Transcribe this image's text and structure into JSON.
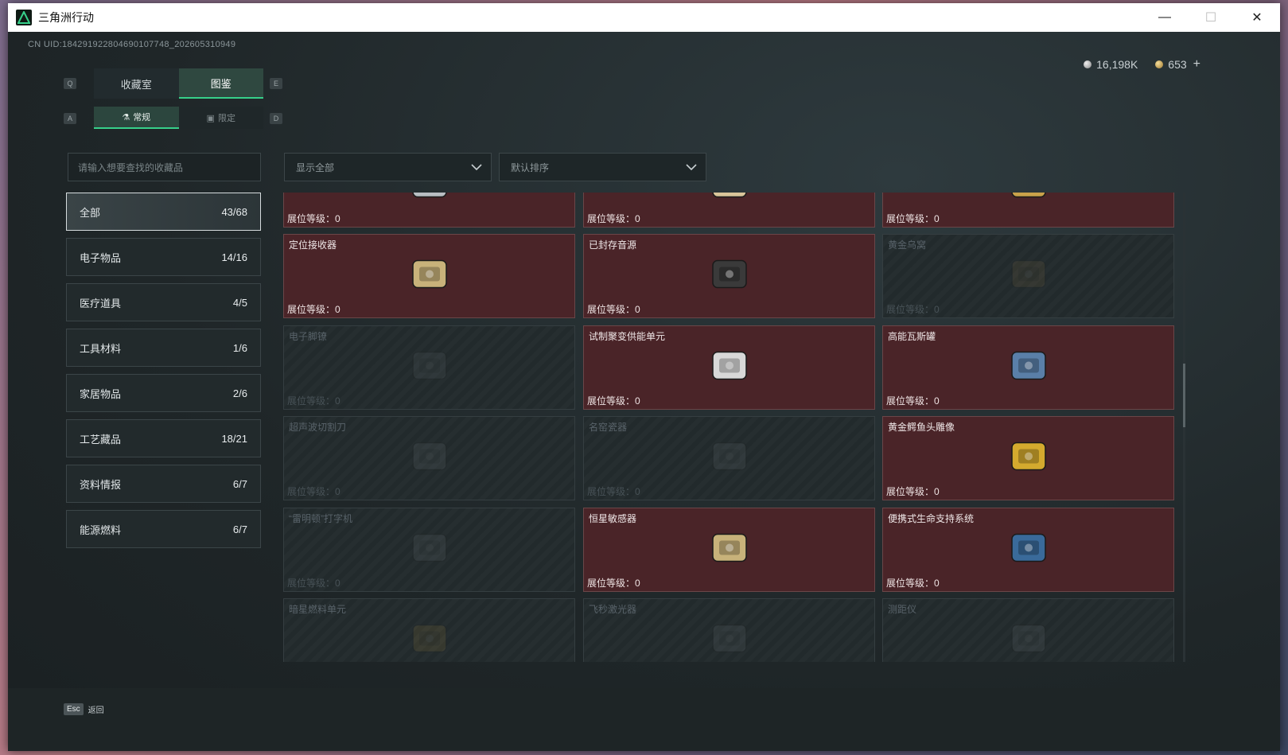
{
  "window": {
    "title": "三角洲行动",
    "controls": {
      "minimize": "—",
      "maximize": "☐",
      "close": "✕"
    }
  },
  "header": {
    "uid": "CN UID:1842919228046901077­48_202605310949",
    "currency_silver": "16,198K",
    "currency_gold": "653",
    "plus": "+"
  },
  "keyhints": {
    "q": "Q",
    "e": "E",
    "a": "A",
    "d": "D"
  },
  "tabs": [
    {
      "label": "收藏室",
      "active": false
    },
    {
      "label": "图鉴",
      "active": true
    }
  ],
  "subtabs": [
    {
      "label": "常规",
      "icon": "flask-icon",
      "active": true
    },
    {
      "label": "限定",
      "icon": "badge-icon",
      "active": false
    }
  ],
  "search": {
    "placeholder": "请输入想要查找的收藏品"
  },
  "filters": {
    "show": "显示全部",
    "sort": "默认排序"
  },
  "categories": [
    {
      "label": "全部",
      "count": "43/68",
      "active": true
    },
    {
      "label": "电子物品",
      "count": "14/16",
      "active": false
    },
    {
      "label": "医疗道具",
      "count": "4/5",
      "active": false
    },
    {
      "label": "工具材料",
      "count": "1/6",
      "active": false
    },
    {
      "label": "家居物品",
      "count": "2/6",
      "active": false
    },
    {
      "label": "工艺藏品",
      "count": "18/21",
      "active": false
    },
    {
      "label": "资料情报",
      "count": "6/7",
      "active": false
    },
    {
      "label": "能源燃料",
      "count": "6/7",
      "active": false
    }
  ],
  "level_label": "展位等级：",
  "items": [
    {
      "name": "",
      "level": "0",
      "owned": true,
      "icon": "flashlight-icon"
    },
    {
      "name": "",
      "level": "0",
      "owned": true,
      "icon": "tapestry-icon"
    },
    {
      "name": "",
      "level": "0",
      "owned": true,
      "icon": "painting-icon"
    },
    {
      "name": "定位接收器",
      "level": "0",
      "owned": true,
      "icon": "receiver-icon"
    },
    {
      "name": "已封存音源",
      "level": "0",
      "owned": true,
      "icon": "tape-recorder-icon"
    },
    {
      "name": "黄金乌窝",
      "level": "0",
      "owned": false,
      "icon": "golden-nest-icon"
    },
    {
      "name": "电子脚镣",
      "level": "0",
      "owned": false,
      "icon": "ankle-monitor-icon"
    },
    {
      "name": "试制聚变供能单元",
      "level": "0",
      "owned": true,
      "icon": "fusion-cell-icon"
    },
    {
      "name": "高能瓦斯罐",
      "level": "0",
      "owned": true,
      "icon": "gas-tank-icon"
    },
    {
      "name": "超声波切割刀",
      "level": "0",
      "owned": false,
      "icon": "ultrasonic-knife-icon"
    },
    {
      "name": "名窑瓷器",
      "level": "0",
      "owned": false,
      "icon": "porcelain-vase-icon"
    },
    {
      "name": "黄金鳄鱼头雕像",
      "level": "0",
      "owned": true,
      "icon": "crocodile-statue-icon"
    },
    {
      "name": "“雷明顿”打字机",
      "level": "0",
      "owned": false,
      "icon": "typewriter-icon"
    },
    {
      "name": "恒星敏感器",
      "level": "0",
      "owned": true,
      "icon": "star-sensor-icon"
    },
    {
      "name": "便携式生命支持系统",
      "level": "0",
      "owned": true,
      "icon": "life-support-icon"
    },
    {
      "name": "暗星燃料单元",
      "level": "",
      "owned": false,
      "icon": "fuel-cell-icon"
    },
    {
      "name": "飞秒激光器",
      "level": "",
      "owned": false,
      "icon": "laser-icon"
    },
    {
      "name": "测距仪",
      "level": "",
      "owned": false,
      "icon": "rangefinder-icon"
    }
  ],
  "footer": {
    "esc_key": "Esc",
    "esc_label": "返回"
  },
  "colors": {
    "accent": "#36d08a",
    "owned_card": "#4a2428",
    "bg": "#1d2427"
  }
}
